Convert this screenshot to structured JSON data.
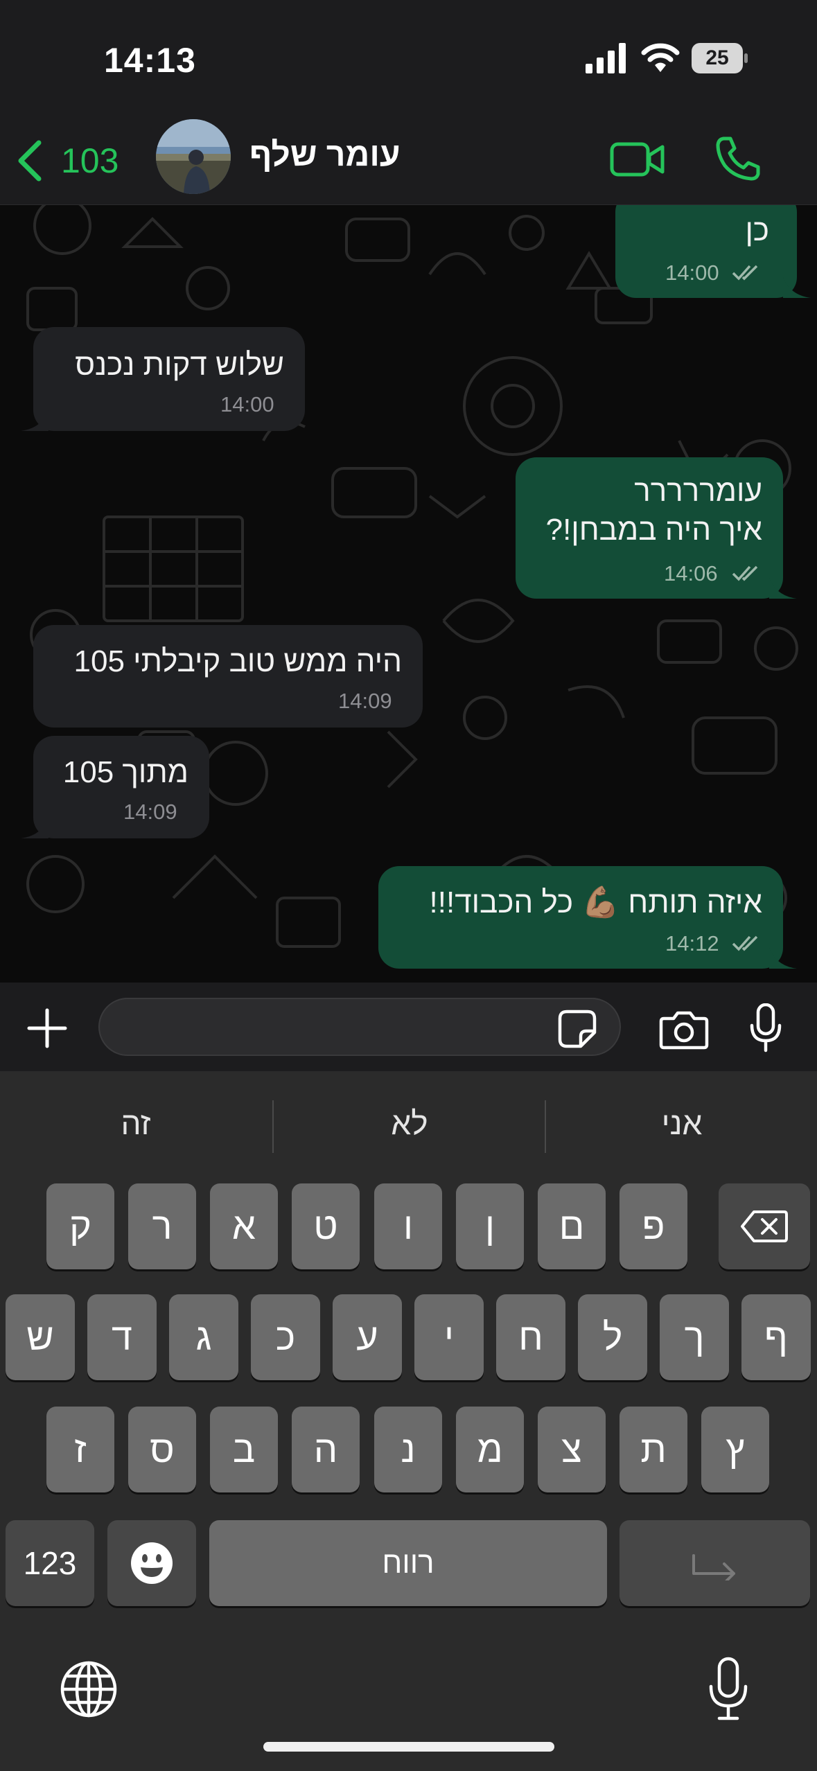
{
  "status_bar": {
    "time": "14:13",
    "battery": "25"
  },
  "header": {
    "back_count": "103",
    "contact_name": "עומר שלף",
    "accent_color": "#25c35a",
    "icons": [
      "chevron-left-icon",
      "video-camera-icon",
      "phone-icon"
    ]
  },
  "messages": [
    {
      "direction": "outgoing",
      "text": "כן",
      "time": "14:00",
      "status": "read"
    },
    {
      "direction": "incoming",
      "text": "שלוש דקות נכנס",
      "time": "14:00"
    },
    {
      "direction": "outgoing",
      "lines": [
        "עומררררר",
        "איך היה במבחן!?"
      ],
      "time": "14:06",
      "status": "read"
    },
    {
      "direction": "incoming",
      "text": "היה ממש טוב קיבלתי 105",
      "time": "14:09"
    },
    {
      "direction": "incoming",
      "text": "מתוך 105",
      "time": "14:09"
    },
    {
      "direction": "outgoing",
      "text": "איזה תותח 💪🏽 כל הכבוד!!!",
      "time": "14:12",
      "status": "read"
    }
  ],
  "input_bar": {
    "placeholder": "",
    "icons": [
      "plus-icon",
      "sticker-icon",
      "camera-icon",
      "microphone-icon"
    ]
  },
  "keyboard": {
    "suggestions": [
      "זה",
      "לא",
      "אני"
    ],
    "row1": [
      "ק",
      "ר",
      "א",
      "ט",
      "ו",
      "ן",
      "ם",
      "פ"
    ],
    "row2": [
      "ש",
      "ד",
      "ג",
      "כ",
      "ע",
      "י",
      "ח",
      "ל",
      "ך",
      "ף"
    ],
    "row3": [
      "ז",
      "ס",
      "ב",
      "ה",
      "נ",
      "מ",
      "צ",
      "ת",
      "ץ"
    ],
    "numbers_key": "123",
    "space_key": "רווח",
    "icons": [
      "backspace-icon",
      "emoji-icon",
      "return-icon",
      "globe-icon",
      "dictation-mic-icon"
    ]
  },
  "colors": {
    "outgoing_bubble": "#134d37",
    "incoming_bubble": "#202124",
    "background": "#0b0b0b"
  }
}
